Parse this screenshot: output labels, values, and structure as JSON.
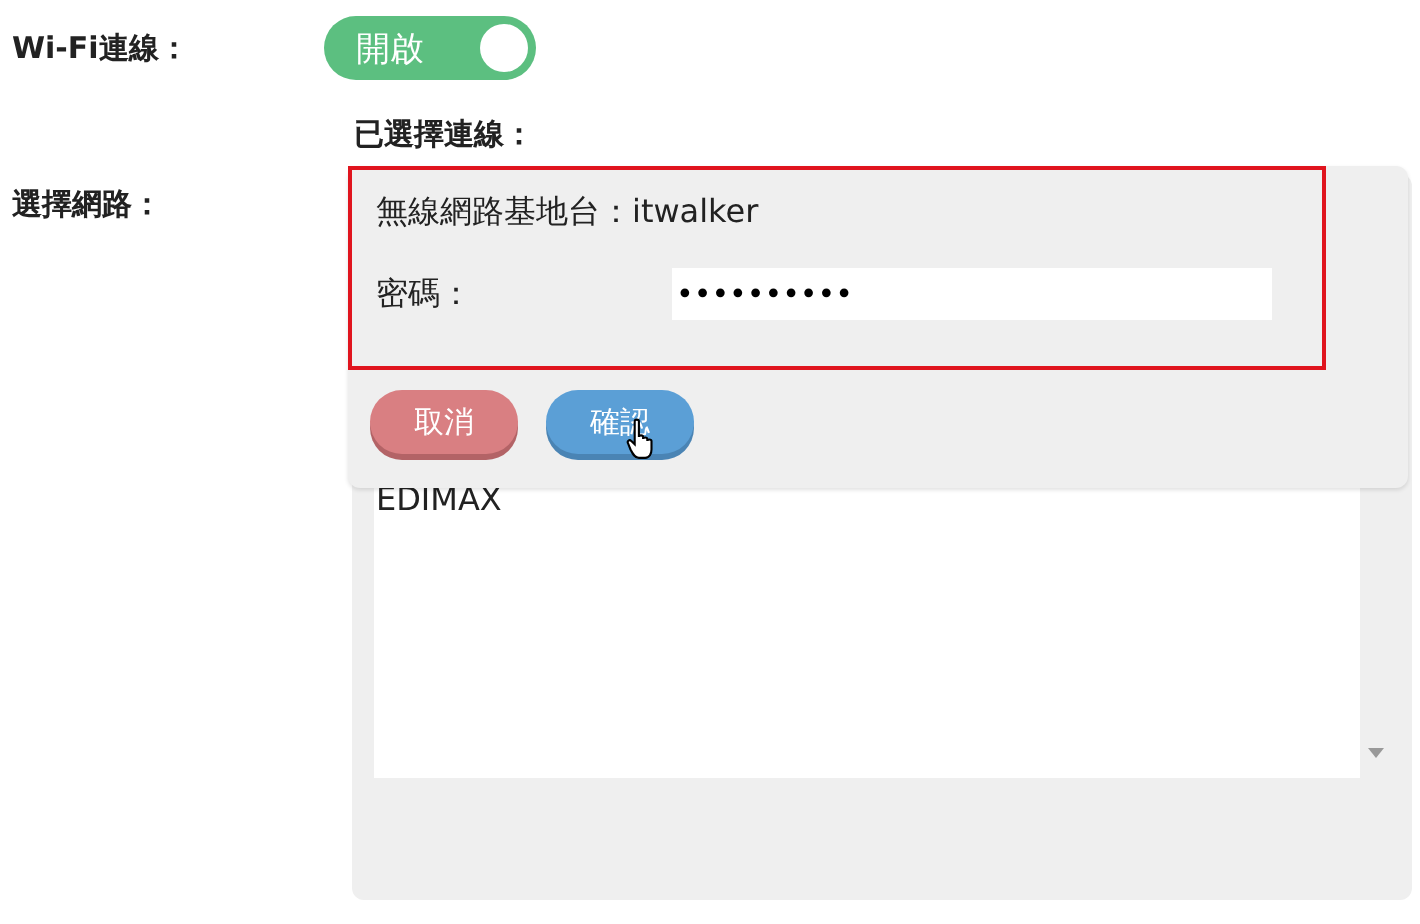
{
  "wifi": {
    "label": "Wi-Fi連線：",
    "toggle": {
      "text": "開啟",
      "on": true
    }
  },
  "selected_connection": {
    "label": "已選擇連線："
  },
  "network": {
    "label": "選擇網路：",
    "dialog": {
      "ssid_label": "無線網路基地台：itwalker",
      "password_label": "密碼：",
      "password_value": "••••••••••",
      "buttons": [
        {
          "kind": "cancel",
          "text": "取消"
        },
        {
          "kind": "confirm",
          "text": "確認"
        }
      ]
    },
    "list": {
      "items": [
        "EDIMAX"
      ]
    }
  }
}
